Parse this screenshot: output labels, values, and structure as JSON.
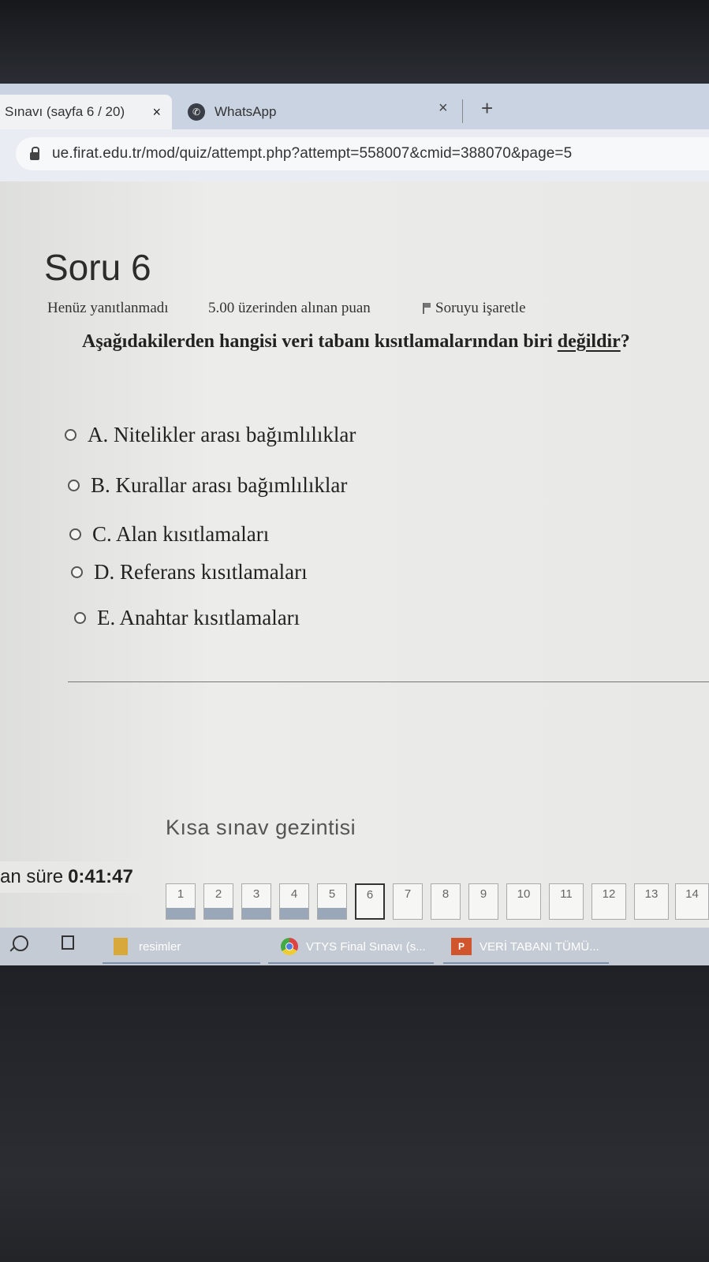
{
  "browser": {
    "tabs": [
      {
        "label": "Sınavı (sayfa 6 / 20)",
        "close": "×"
      },
      {
        "label": "WhatsApp",
        "close": "×"
      }
    ],
    "new_tab": "+",
    "url": "ue.firat.edu.tr/mod/quiz/attempt.php?attempt=558007&cmid=388070&page=5"
  },
  "question": {
    "title": "Soru 6",
    "status": "Henüz yanıtlanmadı",
    "points": "5.00 üzerinden alınan puan",
    "flag_label": "Soruyu işaretle",
    "text": "Aşağıdakilerden hangisi veri tabanı kısıtlamalarından biri ",
    "text_emphasis": "değildir",
    "text_end": "?",
    "options": [
      "A. Nitelikler arası bağımlılıklar",
      "B. Kurallar arası bağımlılıklar",
      "C. Alan kısıtlamaları",
      "D. Referans kısıtlamaları",
      "E. Anahtar kısıtlamaları"
    ]
  },
  "navigation": {
    "title": "Kısa sınav gezintisi",
    "timer_label": "an süre",
    "timer_value": "0:41:47",
    "current": 6,
    "questions": [
      "1",
      "2",
      "3",
      "4",
      "5",
      "6",
      "7",
      "8",
      "9",
      "10",
      "11",
      "12",
      "13",
      "14"
    ]
  },
  "taskbar": {
    "items": [
      "resimler",
      "VTYS Final Sınavı (s...",
      "VERİ TABANI TÜMÜ..."
    ],
    "ppt_icon": "P"
  }
}
